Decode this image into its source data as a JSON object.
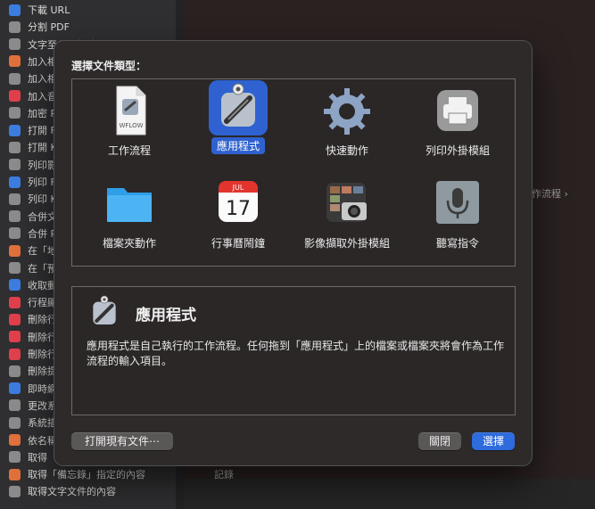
{
  "background": {
    "sidebar_items": [
      {
        "label": "下載 URL",
        "color": "#3c7de0"
      },
      {
        "label": "分割 PDF",
        "color": "#8b8b8b"
      },
      {
        "label": "文字至公開帳號",
        "color": "#8b8b8b"
      },
      {
        "label": "加入相",
        "color": "#e0703c"
      },
      {
        "label": "加入相",
        "color": "#8b8b8b"
      },
      {
        "label": "加入音",
        "color": "#e0404c"
      },
      {
        "label": "加密 P",
        "color": "#8b8b8b"
      },
      {
        "label": "打開 F",
        "color": "#3c7de0"
      },
      {
        "label": "打開 K",
        "color": "#8b8b8b"
      },
      {
        "label": "列印影",
        "color": "#8b8b8b"
      },
      {
        "label": "列印 F",
        "color": "#3c7de0"
      },
      {
        "label": "列印 K",
        "color": "#8b8b8b"
      },
      {
        "label": "合併文",
        "color": "#8b8b8b"
      },
      {
        "label": "合併 P",
        "color": "#8b8b8b"
      },
      {
        "label": "在「地",
        "color": "#e0703c"
      },
      {
        "label": "在「預",
        "color": "#8b8b8b"
      },
      {
        "label": "收取郵",
        "color": "#3c7de0"
      },
      {
        "label": "行程顯",
        "color": "#e0404c"
      },
      {
        "label": "刪除行",
        "color": "#e0404c"
      },
      {
        "label": "刪除行",
        "color": "#e0404c"
      },
      {
        "label": "刪除行",
        "color": "#e0404c"
      },
      {
        "label": "刪除提",
        "color": "#8b8b8b"
      },
      {
        "label": "即時網",
        "color": "#3c7de0"
      },
      {
        "label": "更改系",
        "color": "#8b8b8b"
      },
      {
        "label": "系統描",
        "color": "#8b8b8b"
      },
      {
        "label": "依名稱",
        "color": "#e0703c"
      },
      {
        "label": "取得",
        "color": "#8b8b8b"
      },
      {
        "label": "取得「備忘錄」指定的內容",
        "color": "#e0703c"
      },
      {
        "label": "取得文字文件的內容",
        "color": "#8b8b8b"
      }
    ],
    "breadcrumb": "作流程 ›",
    "bottom_text": "記錄"
  },
  "dialog": {
    "title": "選擇文件類型：",
    "types": [
      {
        "label": "工作流程",
        "icon": "workflow-document-icon",
        "selected": false
      },
      {
        "label": "應用程式",
        "icon": "automator-robot-icon",
        "selected": true
      },
      {
        "label": "快速動作",
        "icon": "gear-icon",
        "selected": false
      },
      {
        "label": "列印外掛模組",
        "icon": "printer-icon",
        "selected": false
      },
      {
        "label": "檔案夾動作",
        "icon": "folder-icon",
        "selected": false
      },
      {
        "label": "行事曆鬧鐘",
        "icon": "calendar-icon",
        "selected": false
      },
      {
        "label": "影像擷取外掛模組",
        "icon": "image-capture-icon",
        "selected": false
      },
      {
        "label": "聽寫指令",
        "icon": "microphone-icon",
        "selected": false
      }
    ],
    "calendar": {
      "month": "JUL",
      "day": "17"
    },
    "workflow_doc_text": "WFLOW",
    "description": {
      "title": "應用程式",
      "text": "應用程式是自己執行的工作流程。任何拖到「應用程式」上的檔案或檔案夾將會作為工作流程的輸入項目。"
    },
    "buttons": {
      "open_existing": "打開現有文件⋯",
      "close": "關閉",
      "choose": "選擇"
    }
  },
  "colors": {
    "accent": "#2f62d0",
    "primary_button": "#2e6bdc"
  }
}
